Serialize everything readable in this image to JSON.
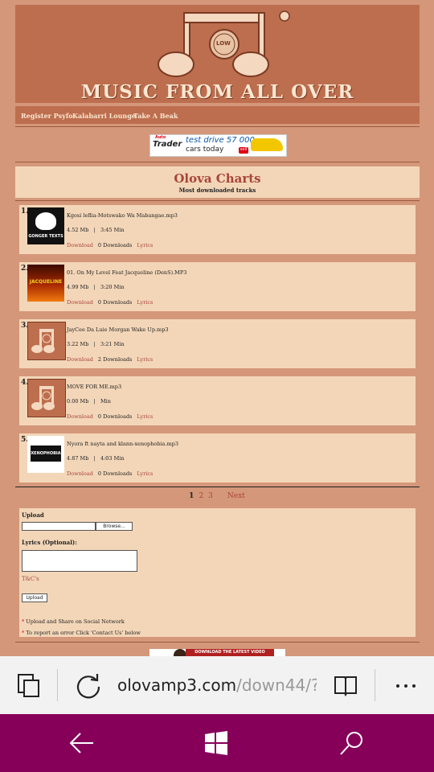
{
  "site": {
    "title": "MUSIC FROM ALL OVER",
    "logo_badge": "LOW"
  },
  "nav": {
    "items": [
      "Register Psyfo",
      "Kalaharri Lounge",
      "Take A Beak"
    ]
  },
  "ad_top": {
    "brand": "Trader",
    "brand_top": "Auto",
    "line1": "test drive 57 000",
    "line2": "cars today",
    "badge": "sell"
  },
  "charts": {
    "title": "Olova Charts",
    "subtitle": "Most downloaded tracks"
  },
  "tracks": [
    {
      "num": "1.",
      "name": "Kgosi leflia-Motswako Wa Mabangae.mp3",
      "size": "4.52 Mb",
      "duration": "3:45 Min",
      "download": "Download",
      "downloads": "0 Downloads",
      "lyrics": "Lyrics",
      "thumb_label": "GONGER TEXTS"
    },
    {
      "num": "2.",
      "name": "01. On My Level Feat Jacqueline (DenS).MP3",
      "size": "4.99 Mb",
      "duration": "3:20 Min",
      "download": "Download",
      "downloads": "0 Downloads",
      "lyrics": "Lyrics",
      "thumb_label": "JACQUELINE"
    },
    {
      "num": "3.",
      "name": "JayCee Da Luie Morgan Wake Up.mp3",
      "size": "3.22 Mb",
      "duration": "3:21 Min",
      "download": "Download",
      "downloads": "2 Downloads",
      "lyrics": "Lyrics",
      "thumb_label": ""
    },
    {
      "num": "4.",
      "name": "MOVE FOR ME.mp3",
      "size": "0.00 Mb",
      "duration": "Min",
      "download": "Download",
      "downloads": "0 Downloads",
      "lyrics": "Lyrics",
      "thumb_label": ""
    },
    {
      "num": "5.",
      "name": "Nyora ft nayta and klann-xenophobia.mp3",
      "size": "4.87 Mb",
      "duration": "4:03 Min",
      "download": "Download",
      "downloads": "0 Downloads",
      "lyrics": "Lyrics",
      "thumb_label": "XENOPHOBIA"
    }
  ],
  "pager": {
    "current": "1",
    "pages": [
      "2",
      "3"
    ],
    "next": "Next"
  },
  "upload": {
    "upload_label": "Upload",
    "browse_label": "Browse...",
    "lyrics_label": "Lyrics (Optional):",
    "tc_label": "T&C's",
    "button_label": "Upload",
    "note1": "Upload and Share on Social Network",
    "note2": "To report an error Click 'Contact Us' below",
    "star": "*"
  },
  "ad_bottom": {
    "text": "DOWNLOAD THE LATEST VIDEO"
  },
  "browser": {
    "url_domain": "olovamp3.com",
    "url_path": "/down44/?",
    "icons": [
      "tabs-icon",
      "refresh-icon",
      "reading-view-icon",
      "more-icon"
    ]
  },
  "taskbar": {
    "icons": [
      "back-icon",
      "windows-icon",
      "search-icon"
    ],
    "color": "#86005a"
  }
}
